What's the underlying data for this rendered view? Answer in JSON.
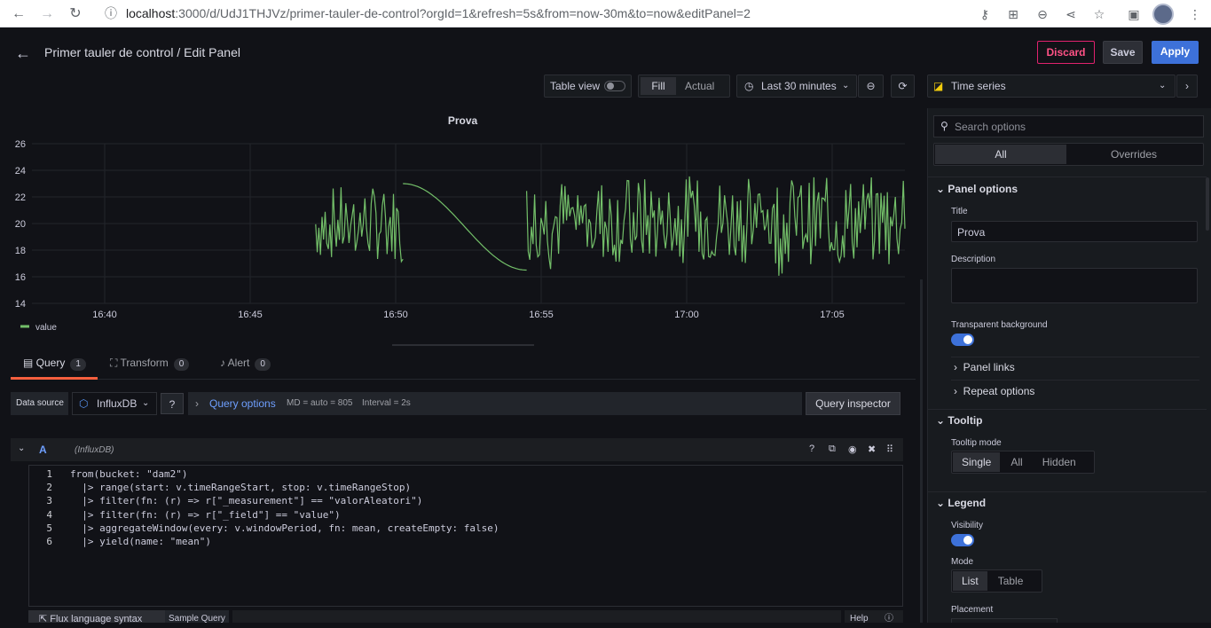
{
  "browser": {
    "url_host": "localhost",
    "url_rest": ":3000/d/UdJ1THJVz/primer-tauler-de-control?orgId=1&refresh=5s&from=now-30m&to=now&editPanel=2"
  },
  "header": {
    "title": "Primer tauler de control / Edit Panel",
    "discard": "Discard",
    "save": "Save",
    "apply": "Apply"
  },
  "toolbar": {
    "table_view": "Table view",
    "fill": "Fill",
    "actual": "Actual",
    "time_range": "Last 30 minutes",
    "viz": "Time series"
  },
  "chart_data": {
    "type": "line",
    "title": "Prova",
    "x_ticks": [
      "16:40",
      "16:45",
      "16:50",
      "16:55",
      "17:00",
      "17:05"
    ],
    "y_ticks": [
      14,
      16,
      18,
      20,
      22,
      24,
      26
    ],
    "ylim": [
      14,
      26
    ],
    "legend": "value",
    "series": [
      {
        "name": "value",
        "color": "#73bf69",
        "segments": [
          {
            "start": "16:47:15",
            "end": "16:50:15",
            "kind": "noise",
            "min": 16,
            "max": 24
          },
          {
            "start": "16:50:15",
            "end": "16:54:30",
            "kind": "decay",
            "from": 23,
            "to": 16.5
          },
          {
            "start": "16:54:30",
            "end": "17:07:30",
            "kind": "noise",
            "min": 15.5,
            "max": 25
          }
        ]
      }
    ]
  },
  "tabs": [
    {
      "label": "Query",
      "count": "1"
    },
    {
      "label": "Transform",
      "count": "0"
    },
    {
      "label": "Alert",
      "count": "0"
    }
  ],
  "datasource": {
    "label": "Data source",
    "value": "InfluxDB",
    "query_options": "Query options",
    "md": "MD = auto = 805",
    "interval": "Interval = 2s",
    "inspector": "Query inspector"
  },
  "query": {
    "refid": "A",
    "ds": "(InfluxDB)",
    "footer_tab1": "Flux language syntax",
    "footer_tab2": "Sample Query",
    "help": "Help"
  },
  "code": [
    "from(bucket: \"dam2\")",
    "  |> range(start: v.timeRangeStart, stop: v.timeRangeStop)",
    "  |> filter(fn: (r) => r[\"_measurement\"] == \"valorAleatori\")",
    "  |> filter(fn: (r) => r[\"_field\"] == \"value\")",
    "  |> aggregateWindow(every: v.windowPeriod, fn: mean, createEmpty: false)",
    "  |> yield(name: \"mean\")"
  ],
  "options": {
    "search_placeholder": "Search options",
    "all": "All",
    "overrides": "Overrides",
    "panel_options": "Panel options",
    "title_label": "Title",
    "title_value": "Prova",
    "description_label": "Description",
    "transparent_label": "Transparent background",
    "panel_links": "Panel links",
    "repeat_options": "Repeat options",
    "tooltip": "Tooltip",
    "tooltip_mode": "Tooltip mode",
    "single": "Single",
    "all_mode": "All",
    "hidden": "Hidden",
    "legend": "Legend",
    "visibility": "Visibility",
    "mode": "Mode",
    "list": "List",
    "table": "Table",
    "placement": "Placement"
  }
}
